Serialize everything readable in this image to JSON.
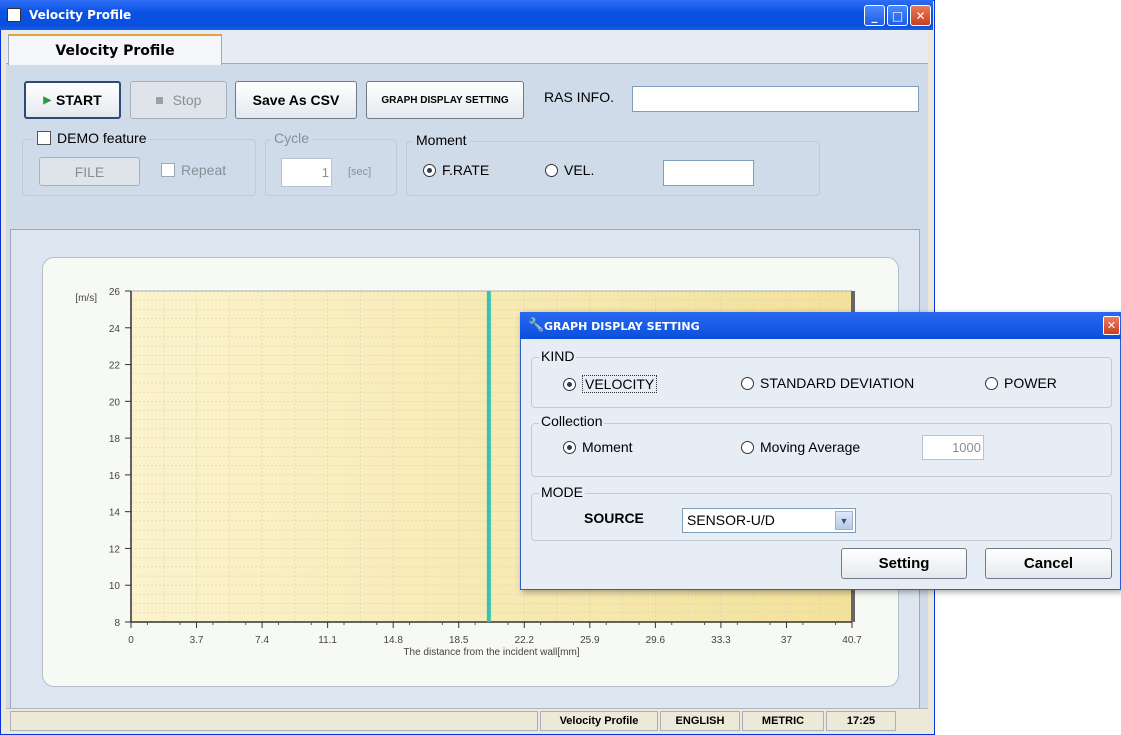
{
  "window": {
    "title": "Velocity Profile",
    "buttons": {
      "minimize": "_",
      "maximize": "□",
      "close": "✕"
    }
  },
  "tabs": [
    {
      "label": "Velocity Profile",
      "active": true
    }
  ],
  "toolbar": {
    "start_label": "START",
    "stop_label": "Stop",
    "save_csv_label": "Save As CSV",
    "graph_setting_label": "GRAPH DISPLAY SETTING",
    "ras_info_label": "RAS INFO.",
    "ras_info_value": ""
  },
  "demo": {
    "title": "DEMO feature",
    "checked": false,
    "file_label": "FILE",
    "repeat_label": "Repeat",
    "repeat_checked": false
  },
  "cycle": {
    "title": "Cycle",
    "value": "1",
    "unit": "[sec]"
  },
  "moment": {
    "title": "Moment",
    "options": [
      {
        "label": "F.RATE",
        "selected": true
      },
      {
        "label": "VEL.",
        "selected": false
      }
    ],
    "value": ""
  },
  "chart_data": {
    "type": "line",
    "xlabel": "The distance from the incident wall[mm]",
    "ylabel": "[m/s]",
    "x_ticks": [
      "0",
      "3.7",
      "7.4",
      "11.1",
      "14.8",
      "18.5",
      "22.2",
      "25.9",
      "29.6",
      "33.3",
      "37",
      "40.7"
    ],
    "x_tick_values": [
      0,
      3.7,
      7.4,
      11.1,
      14.8,
      18.5,
      22.2,
      25.9,
      29.6,
      33.3,
      37,
      40.7
    ],
    "y_ticks": [
      "26",
      "24",
      "22",
      "20",
      "18",
      "16",
      "14",
      "12",
      "10",
      "8"
    ],
    "y_tick_values": [
      26,
      24,
      22,
      20,
      18,
      16,
      14,
      12,
      10,
      8
    ],
    "xlim": [
      0,
      40.7
    ],
    "ylim": [
      8,
      26
    ],
    "grid": true,
    "marker_x": 20.2,
    "marker_color": "#33c3b6",
    "series": []
  },
  "status": {
    "segments": [
      "Velocity Profile",
      "ENGLISH",
      "METRIC",
      "17:25"
    ]
  },
  "dialog": {
    "title": "GRAPH DISPLAY SETTING",
    "close": "✕",
    "kind": {
      "title": "KIND",
      "options": [
        {
          "label": "VELOCITY",
          "selected": true
        },
        {
          "label": "STANDARD DEVIATION",
          "selected": false
        },
        {
          "label": "POWER",
          "selected": false
        }
      ]
    },
    "collection": {
      "title": "Collection",
      "options": [
        {
          "label": "Moment",
          "selected": true
        },
        {
          "label": "Moving Average",
          "selected": false
        }
      ],
      "average_value": "1000"
    },
    "mode": {
      "title": "MODE",
      "source_label": "SOURCE",
      "source_value": "SENSOR-U/D"
    },
    "setting_label": "Setting",
    "cancel_label": "Cancel"
  },
  "colors": {
    "titlebar": "#0a52e6",
    "plot_fill": "#f9edb5",
    "marker": "#33c3b6"
  }
}
